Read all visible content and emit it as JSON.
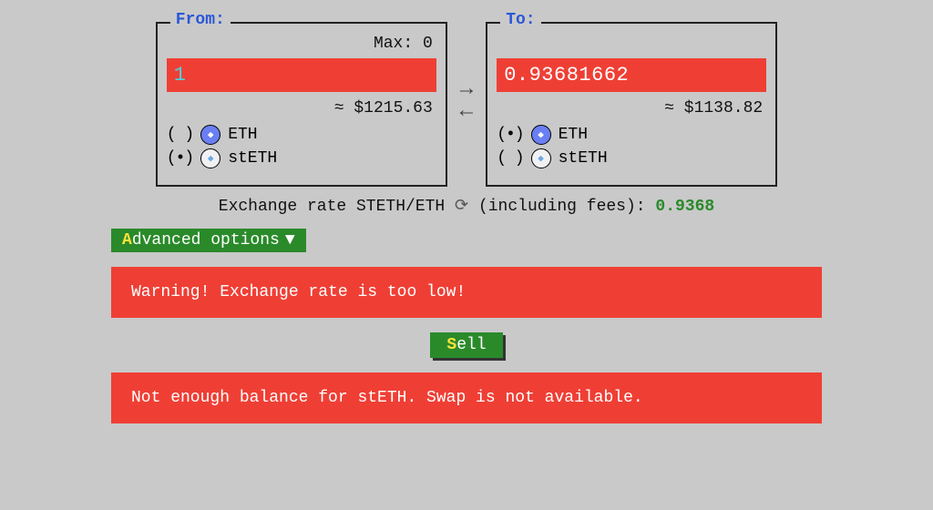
{
  "from": {
    "legend": "From:",
    "max_label": "Max:",
    "max_value": "0",
    "amount": "1",
    "usd": "≈ $1215.63",
    "options": [
      {
        "radio": "( )",
        "symbol": "ETH",
        "icon": "eth"
      },
      {
        "radio": "(•)",
        "symbol": "stETH",
        "icon": "steth"
      }
    ]
  },
  "to": {
    "legend": "To:",
    "amount": "0.93681662",
    "usd": "≈ $1138.82",
    "options": [
      {
        "radio": "(•)",
        "symbol": "ETH",
        "icon": "eth"
      },
      {
        "radio": "( )",
        "symbol": "stETH",
        "icon": "steth"
      }
    ]
  },
  "rate": {
    "prefix": "Exchange rate STETH/ETH",
    "suffix": "(including fees):",
    "value": "0.9368"
  },
  "advanced": {
    "first_letter": "A",
    "rest": "dvanced options",
    "arrow": "▼"
  },
  "warning1": "Warning! Exchange rate is too low!",
  "sell": {
    "first_letter": "S",
    "rest": "ell"
  },
  "warning2": "Not enough balance for stETH. Swap is not available."
}
